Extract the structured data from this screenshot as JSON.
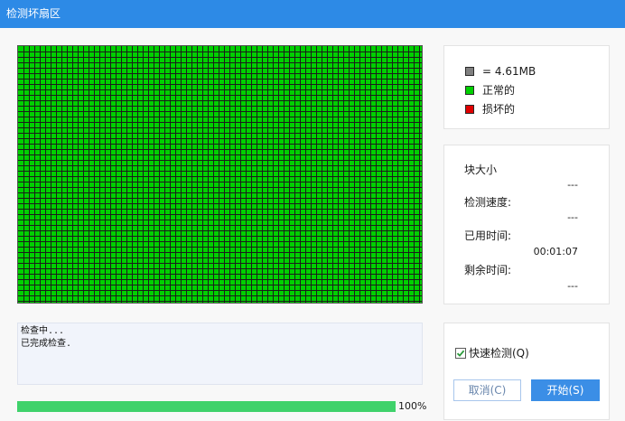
{
  "window": {
    "title": "检测坏扇区"
  },
  "legend": {
    "items": [
      {
        "label": "= 4.61MB",
        "color": "#808080"
      },
      {
        "label": "正常的",
        "color": "#00d000"
      },
      {
        "label": "损坏的",
        "color": "#e00000"
      }
    ]
  },
  "stats": {
    "block_size_label": "块大小",
    "block_size_value": "---",
    "speed_label": "检测速度:",
    "speed_value": "---",
    "elapsed_label": "已用时间:",
    "elapsed_value": "00:01:07",
    "remaining_label": "剩余时间:",
    "remaining_value": "---"
  },
  "log": {
    "lines": [
      "检查中...",
      "已完成检查."
    ]
  },
  "controls": {
    "quick_check_label": "快速检测(Q)",
    "quick_check_checked": true,
    "cancel_label": "取消(C)",
    "start_label": "开始(S)"
  },
  "progress": {
    "value": 1.0,
    "label": "100%"
  },
  "sector_map": {
    "block_color": "#00d000",
    "grid_color": "#1c1c1c"
  }
}
